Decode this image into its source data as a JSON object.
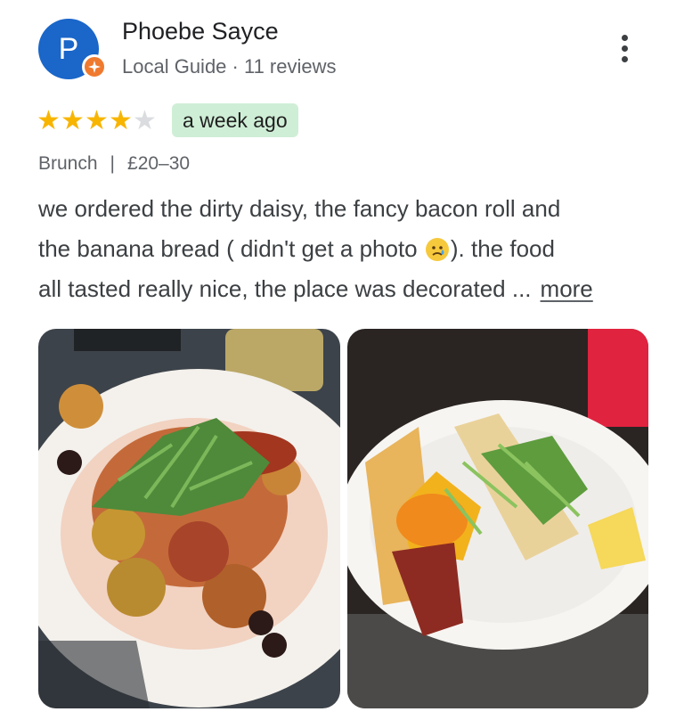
{
  "reviewer": {
    "initial": "P",
    "name": "Phoebe Sayce",
    "subtitle": "Local Guide · 11 reviews",
    "badge_icon": "local-guide-star-icon",
    "avatar_color": "#1a66c9"
  },
  "review": {
    "rating": 4,
    "max_rating": 5,
    "date": "a week ago",
    "category": "Brunch",
    "separator": "|",
    "price": "£20–30",
    "lines": [
      "we ordered the dirty daisy, the fancy bacon roll and",
      "the banana bread ( didn't get a photo",
      "). the food",
      "all tasted really nice, the place was decorated ..."
    ],
    "more_label": "more"
  },
  "photos": [
    {
      "icon": "food-photo-dirty-daisy"
    },
    {
      "icon": "food-photo-bacon-roll"
    }
  ],
  "colors": {
    "star_on": "#f8b500",
    "star_off": "#dadce0",
    "date_chip": "#cfeed6",
    "badge": "#ef7a2f"
  }
}
